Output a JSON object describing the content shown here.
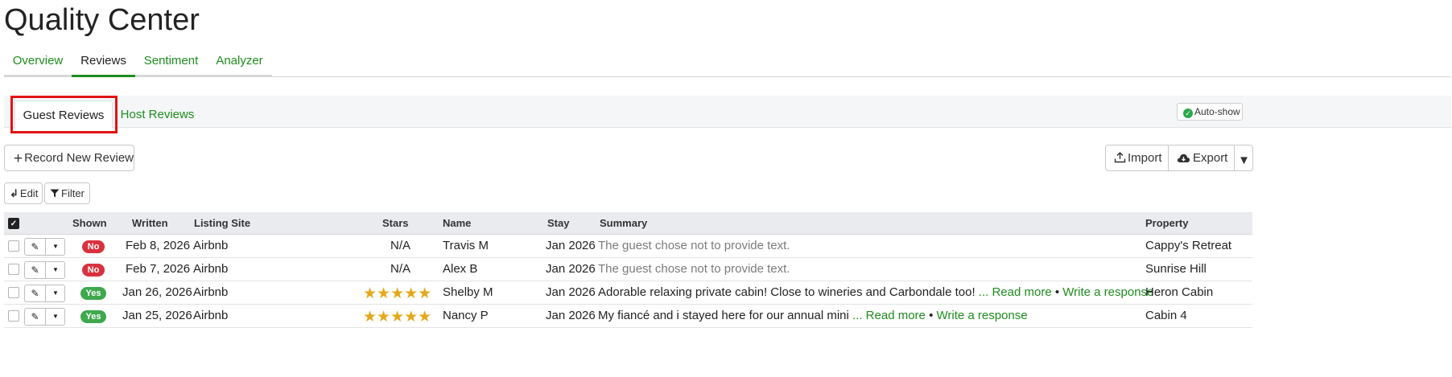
{
  "page": {
    "title": "Quality Center"
  },
  "main_tabs": [
    {
      "label": "Overview",
      "active": false
    },
    {
      "label": "Reviews",
      "active": true
    },
    {
      "label": "Sentiment",
      "active": false
    },
    {
      "label": "Analyzer",
      "active": false
    }
  ],
  "sub_tabs": [
    {
      "label": "Guest Reviews",
      "active": true
    },
    {
      "label": "Host Reviews",
      "active": false
    }
  ],
  "auto_show": {
    "label": "Auto-show",
    "checked": true
  },
  "toolbar": {
    "record_label": "Record New Review",
    "import_label": "Import",
    "export_label": "Export",
    "edit_label": "Edit",
    "filter_label": "Filter"
  },
  "table": {
    "columns": [
      "Shown",
      "Written",
      "Listing Site",
      "Stars",
      "Name",
      "Stay",
      "Summary",
      "Property"
    ],
    "rows": [
      {
        "shown": "No",
        "written": "Feb 8, 2026",
        "site": "Airbnb",
        "stars": "N/A",
        "name": "Travis M",
        "stay": "Jan 2026",
        "summary": "The guest chose not to provide text.",
        "summary_muted": true,
        "read_more": "",
        "separator": "",
        "write_response": "",
        "property": "Cappy's Retreat"
      },
      {
        "shown": "No",
        "written": "Feb 7, 2026",
        "site": "Airbnb",
        "stars": "N/A",
        "name": "Alex B",
        "stay": "Jan 2026",
        "summary": "The guest chose not to provide text.",
        "summary_muted": true,
        "read_more": "",
        "separator": "",
        "write_response": "",
        "property": "Sunrise Hill"
      },
      {
        "shown": "Yes",
        "written": "Jan 26, 2026",
        "site": "Airbnb",
        "stars": "★★★★★",
        "star_rating": 5,
        "name": "Shelby M",
        "stay": "Jan 2026",
        "summary": "Adorable relaxing private cabin! Close to wineries and Carbondale too!",
        "summary_muted": false,
        "read_more": "... Read more",
        "separator": "•",
        "write_response": "Write a response",
        "property": "Heron Cabin"
      },
      {
        "shown": "Yes",
        "written": "Jan 25, 2026",
        "site": "Airbnb",
        "stars": "★★★★★",
        "star_rating": 5,
        "name": "Nancy P",
        "stay": "Jan 2026",
        "summary": "My fiancé and i stayed here for our annual mini",
        "summary_muted": false,
        "read_more": "... Read more",
        "separator": "•",
        "write_response": "Write a response",
        "property": "Cabin 4"
      }
    ]
  },
  "colors": {
    "accent_green": "#1e8c1e",
    "badge_no": "#d9313e",
    "badge_yes": "#3fa84d",
    "star": "#e3a91a",
    "highlight": "#e21212"
  }
}
